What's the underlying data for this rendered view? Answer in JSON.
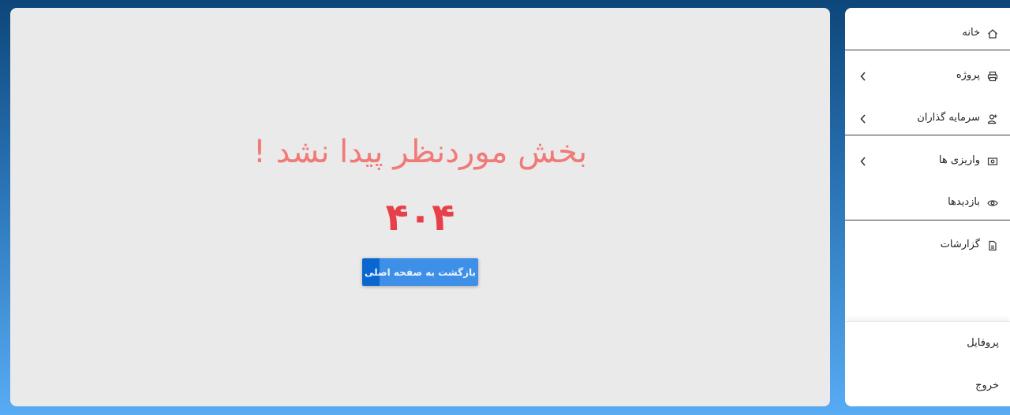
{
  "main": {
    "error_message": "بخش موردنظر پیدا نشد !",
    "error_code": "۴۰۴",
    "home_button_label": "بازگشت به صفحه اصلی"
  },
  "sidebar": {
    "items": [
      {
        "label": "خانه",
        "icon": "home-icon",
        "has_submenu": false
      },
      {
        "label": "پروژه",
        "icon": "printer-icon",
        "has_submenu": true
      },
      {
        "label": "سرمایه گذاران",
        "icon": "user-plus-icon",
        "has_submenu": true
      },
      {
        "label": "واریزی ها",
        "icon": "money-icon",
        "has_submenu": true
      },
      {
        "label": "بازدیدها",
        "icon": "eye-icon",
        "has_submenu": false
      },
      {
        "label": "گزارشات",
        "icon": "file-report-icon",
        "has_submenu": false
      }
    ],
    "bottom": {
      "profile_label": "پروفایل",
      "logout_label": "خروج"
    }
  },
  "colors": {
    "error_message": "#f07a78",
    "error_code": "#e8404b",
    "button": "#3d8fe8",
    "panel": "#eaeaea"
  }
}
